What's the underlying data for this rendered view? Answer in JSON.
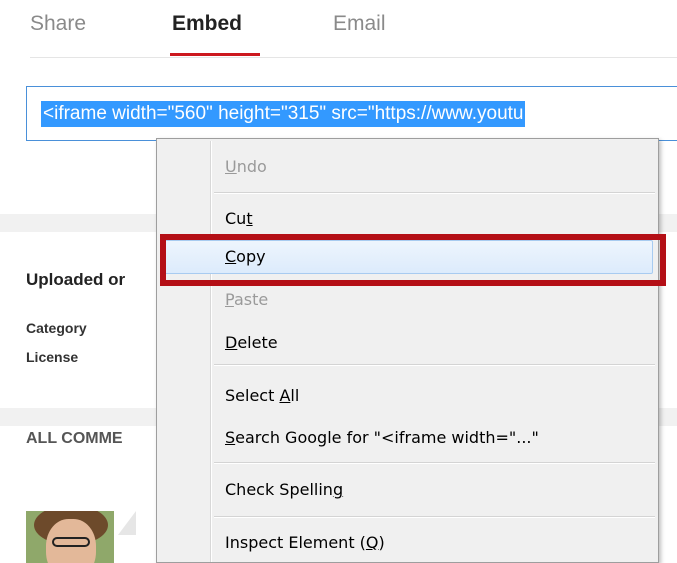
{
  "tabs": {
    "share": "Share",
    "embed": "Embed",
    "email": "Email"
  },
  "embed_code": "<iframe width=\"560\" height=\"315\" src=\"https://www.youtu",
  "details": {
    "uploaded": "Uploaded or",
    "category_label": "Category",
    "license_label": "License"
  },
  "comments_header": "ALL COMME",
  "context_menu": {
    "undo": {
      "pre": "",
      "key": "U",
      "post": "ndo"
    },
    "cut": {
      "pre": "Cu",
      "key": "t",
      "post": ""
    },
    "copy": {
      "pre": "",
      "key": "C",
      "post": "opy"
    },
    "paste": {
      "pre": "",
      "key": "P",
      "post": "aste"
    },
    "delete": {
      "pre": "",
      "key": "D",
      "post": "elete"
    },
    "select_all": {
      "pre": "Select ",
      "key": "A",
      "post": "ll"
    },
    "search_google": {
      "pre": "",
      "key": "S",
      "post": "earch Google for \"<iframe width=\"...\""
    },
    "check_spelling": {
      "pre": "Check Spellin",
      "key": "g",
      "post": ""
    },
    "inspect": {
      "pre": "Inspect Element (",
      "key": "Q",
      "post": ")"
    }
  },
  "colors": {
    "accent_red": "#cc181e",
    "selection_blue": "#3399ff",
    "highlight_frame": "#b40f16"
  }
}
